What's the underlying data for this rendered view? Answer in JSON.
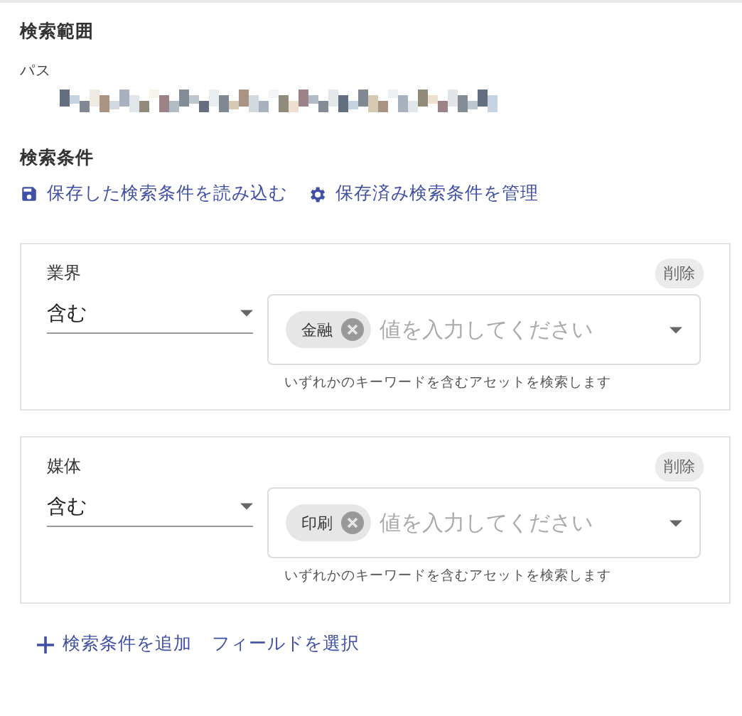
{
  "scope": {
    "title": "検索範囲",
    "path_label": "パス"
  },
  "conditions": {
    "title": "検索条件",
    "actions": [
      {
        "label": "保存した検索条件を読み込む"
      },
      {
        "label": "保存済み検索条件を管理"
      }
    ],
    "items": [
      {
        "field": "業界",
        "delete_label": "削除",
        "operator": "含む",
        "chips": [
          "金融"
        ],
        "placeholder": "値を入力してください",
        "helper": "いずれかのキーワードを含むアセットを検索します"
      },
      {
        "field": "媒体",
        "delete_label": "削除",
        "operator": "含む",
        "chips": [
          "印刷"
        ],
        "placeholder": "値を入力してください",
        "helper": "いずれかのキーワードを含むアセットを検索します"
      }
    ],
    "footer": [
      {
        "label": "検索条件を追加"
      },
      {
        "label": "フィールドを選択"
      }
    ]
  }
}
